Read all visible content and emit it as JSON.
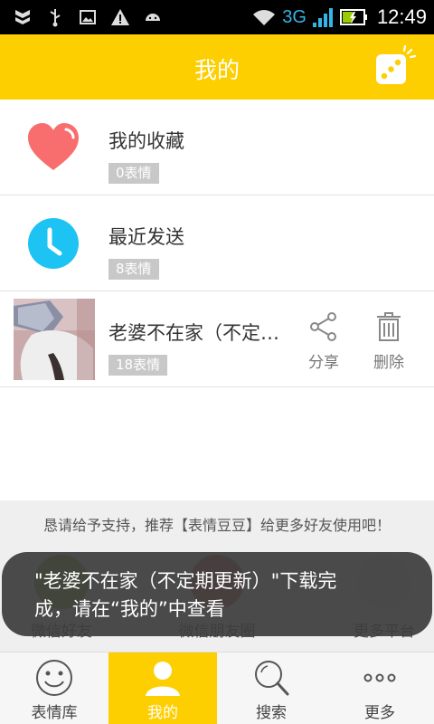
{
  "status_bar": {
    "network": "3G",
    "time": "12:49",
    "icons": [
      "shield-icon",
      "usb-icon",
      "image-icon",
      "warning-icon",
      "android-icon",
      "wifi-icon",
      "signal-icon",
      "battery-icon"
    ]
  },
  "header": {
    "title": "我的",
    "random_icon": "dice-icon"
  },
  "list": [
    {
      "title": "我的收藏",
      "badge": "0表情",
      "icon": "heart-icon",
      "color": "#f86e6e"
    },
    {
      "title": "最近发送",
      "badge": "8表情",
      "icon": "clock-icon",
      "color": "#1dc3f2"
    },
    {
      "title": "老婆不在家（不定…",
      "badge": "18表情",
      "icon": "thumbnail",
      "actions": {
        "share": "分享",
        "delete": "删除"
      }
    }
  ],
  "share_sheet": {
    "prompt": "恳请给予支持，推荐【表情豆豆】给更多好友使用吧！",
    "targets": [
      "微信好友",
      "微信朋友圈",
      "更多平台"
    ]
  },
  "toast": {
    "line1": "\"老婆不在家（不定期更新）\"下载完",
    "line2": "成，请在“我的”中查看"
  },
  "tabs": [
    {
      "label": "表情库",
      "icon": "smiley-icon"
    },
    {
      "label": "我的",
      "icon": "person-icon",
      "active": true
    },
    {
      "label": "搜索",
      "icon": "search-icon"
    },
    {
      "label": "更多",
      "icon": "more-icon"
    }
  ],
  "colors": {
    "accent": "#fdce00",
    "heart": "#f86e6e",
    "clock": "#1dc3f2",
    "badge": "#c8c8c8"
  }
}
